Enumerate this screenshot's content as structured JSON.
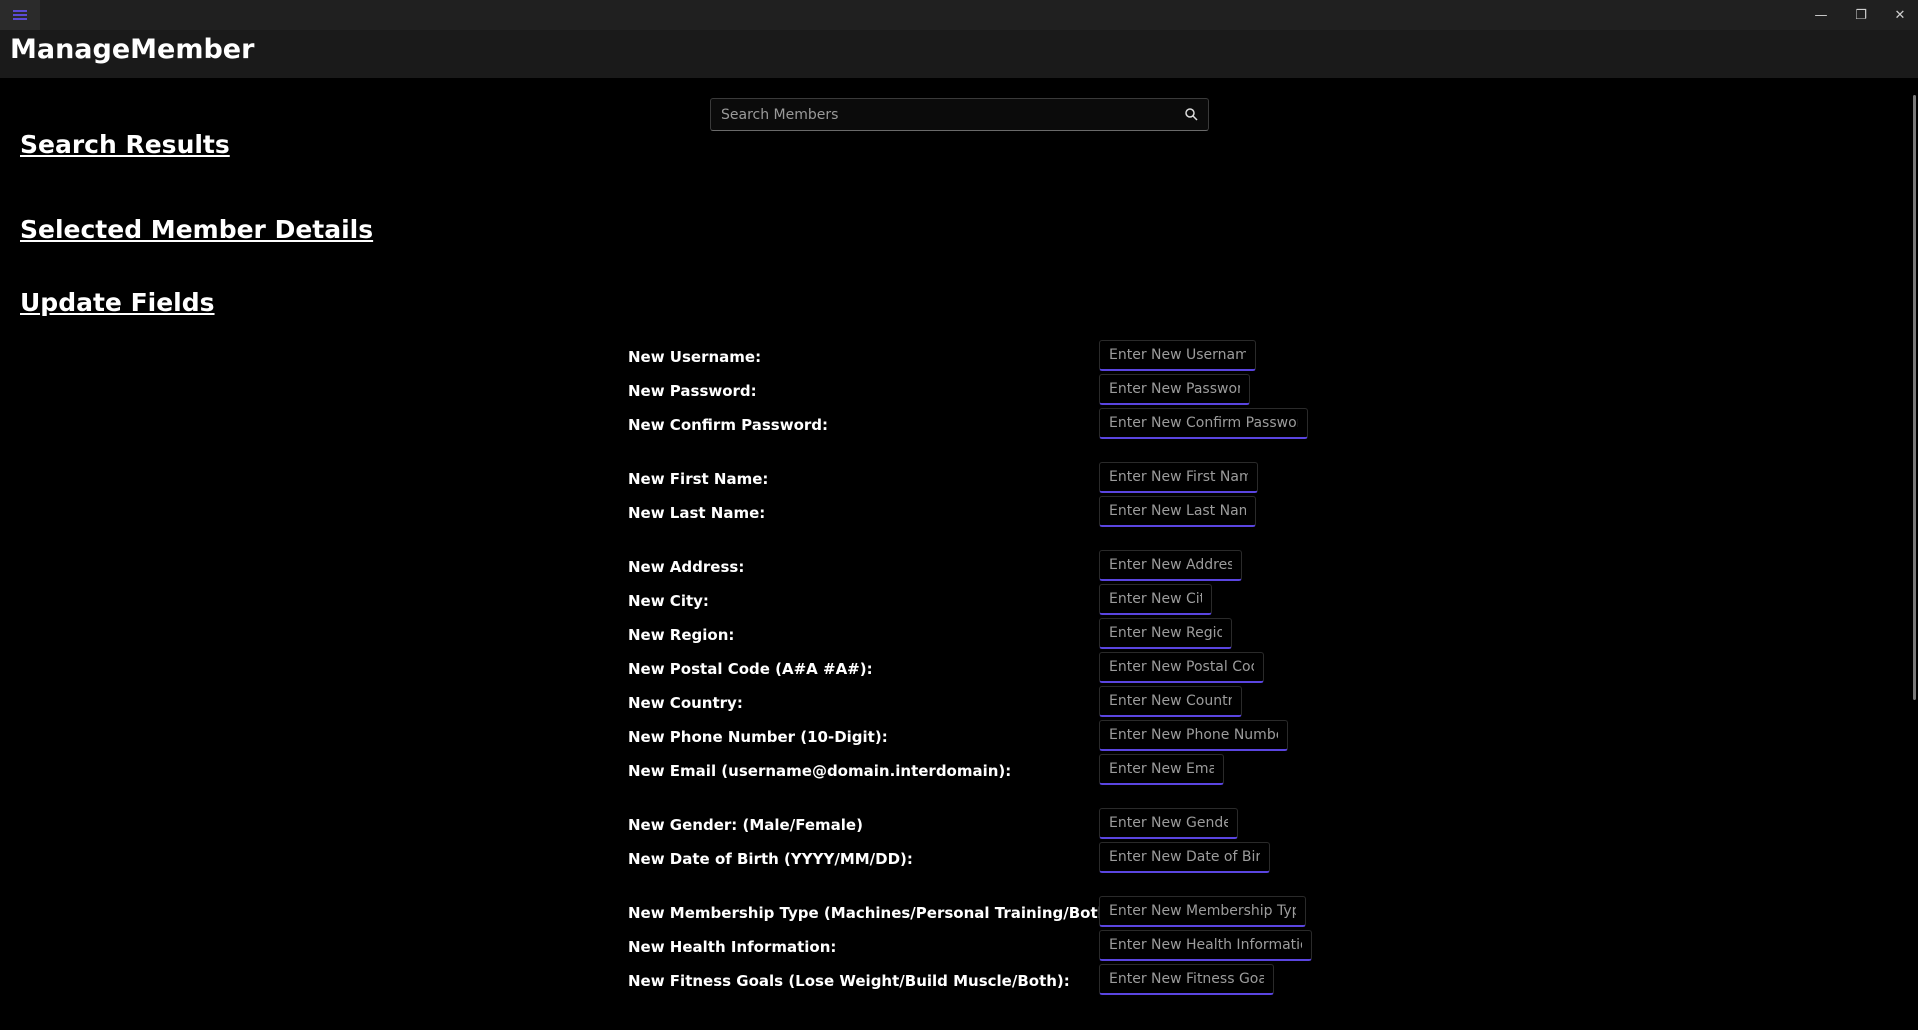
{
  "window": {
    "minimize_glyph": "—",
    "restore_glyph": "❐",
    "close_glyph": "✕"
  },
  "header": {
    "title": "ManageMember"
  },
  "search": {
    "placeholder": "Search Members",
    "icon": "search-icon"
  },
  "sections": {
    "search_results": "Search Results",
    "selected_member": "Selected Member Details",
    "update_fields": "Update Fields"
  },
  "fields": [
    {
      "label": "New Username:",
      "placeholder": "Enter New Username"
    },
    {
      "label": "New Password:",
      "placeholder": "Enter New Password"
    },
    {
      "label": "New Confirm Password:",
      "placeholder": "Enter New Confirm Password"
    },
    {
      "label": "New First Name:",
      "placeholder": "Enter New First Name"
    },
    {
      "label": "New Last Name:",
      "placeholder": "Enter New Last Name"
    },
    {
      "label": "New Address:",
      "placeholder": "Enter New Address"
    },
    {
      "label": "New City:",
      "placeholder": "Enter New City"
    },
    {
      "label": "New Region:",
      "placeholder": "Enter New Region"
    },
    {
      "label": "New Postal Code (A#A #A#):",
      "placeholder": "Enter New Postal Code"
    },
    {
      "label": "New Country:",
      "placeholder": "Enter New Country"
    },
    {
      "label": "New Phone Number (10-Digit):",
      "placeholder": "Enter New Phone Number"
    },
    {
      "label": "New Email (username@domain.interdomain):",
      "placeholder": "Enter New Email"
    },
    {
      "label": "New Gender: (Male/Female)",
      "placeholder": "Enter New Gender"
    },
    {
      "label": "New Date of Birth (YYYY/MM/DD):",
      "placeholder": "Enter New Date of Birth"
    },
    {
      "label": "New Membership Type (Machines/Personal Training/Both):",
      "placeholder": "Enter New Membership Type"
    },
    {
      "label": "New Health Information:",
      "placeholder": "Enter New Health Information"
    },
    {
      "label": "New Fitness Goals (Lose Weight/Build Muscle/Both):",
      "placeholder": "Enter New Fitness Goals"
    }
  ],
  "colors": {
    "accent": "#5a45e0",
    "background": "#000000",
    "titlebar": "#202020",
    "header": "#1a1a1a"
  }
}
